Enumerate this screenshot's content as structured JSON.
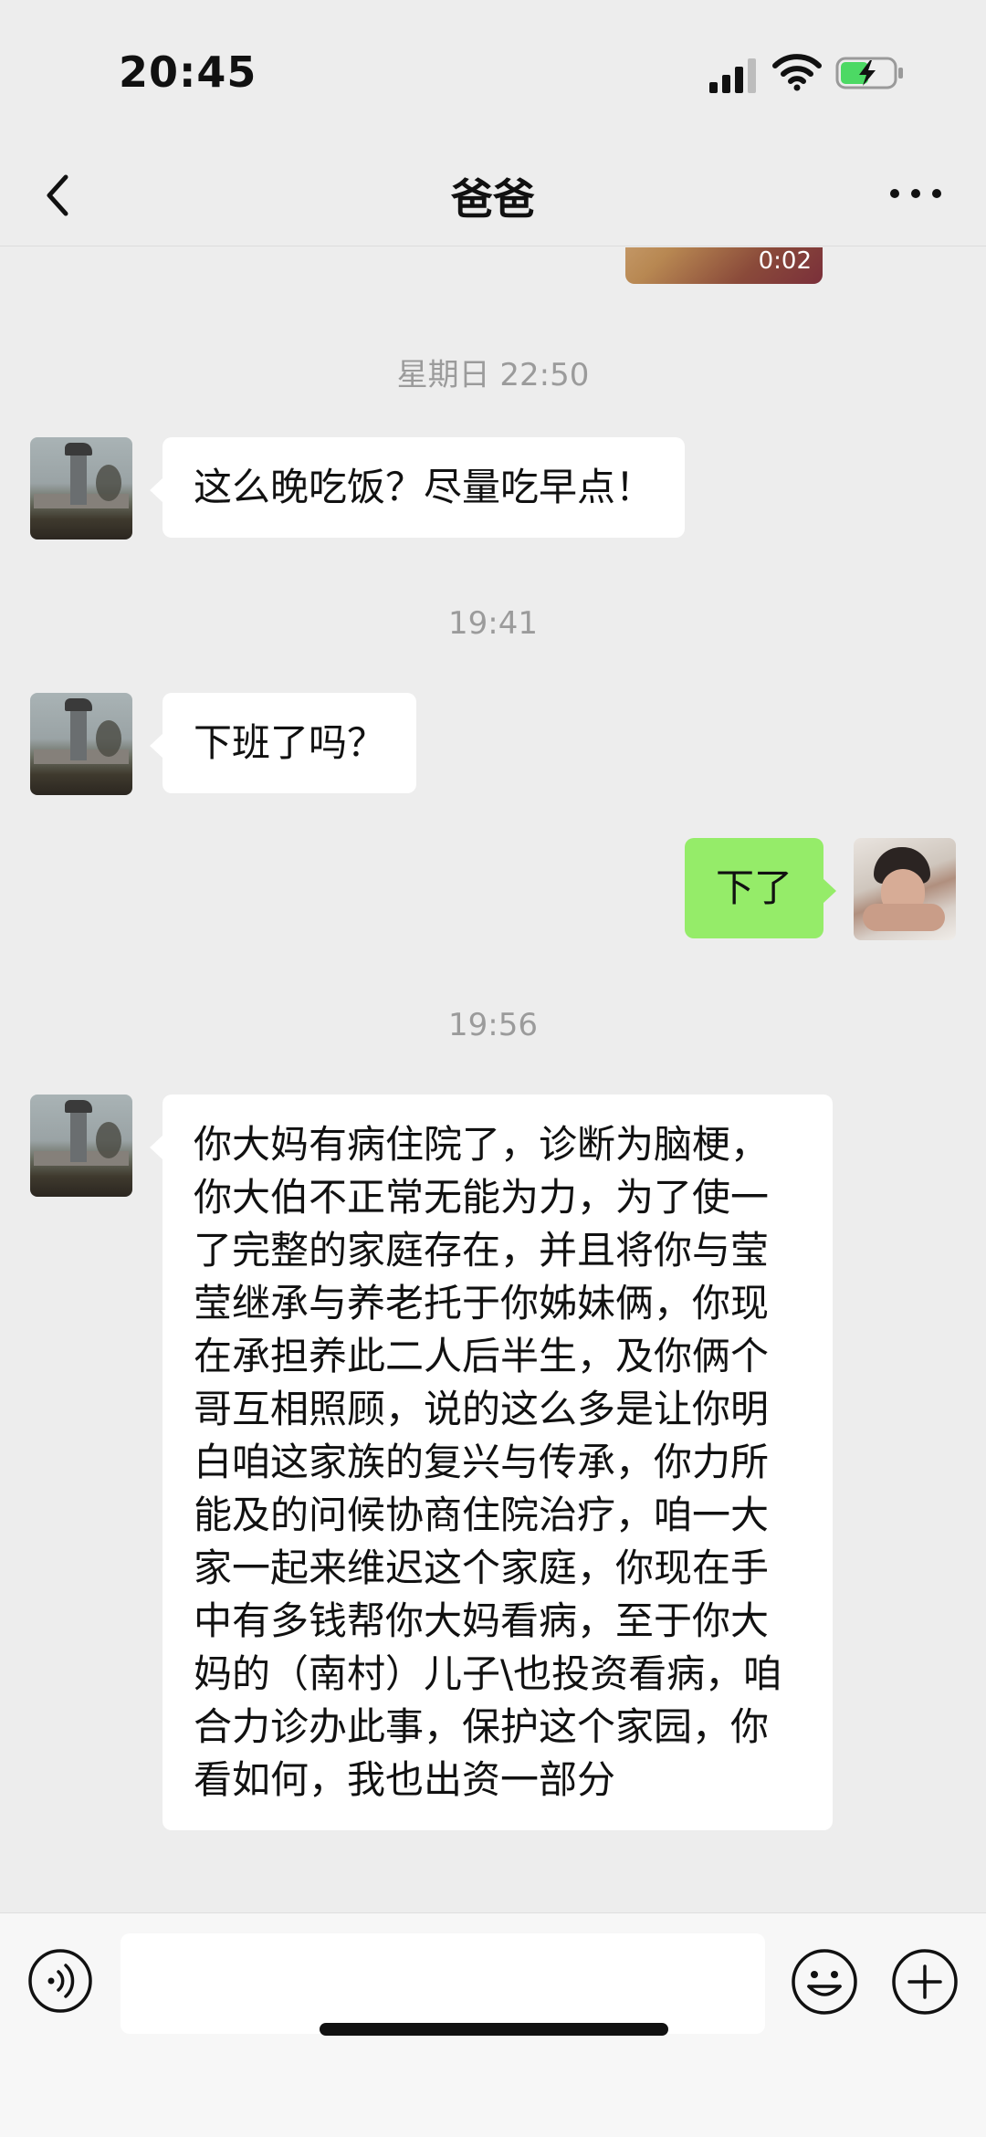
{
  "status_bar": {
    "time": "20:45",
    "icons": [
      "signal-icon",
      "wifi-icon",
      "battery-charging-icon"
    ]
  },
  "nav": {
    "title": "爸爸",
    "back_icon": "chevron-left-icon",
    "more_icon": "more-dots-icon"
  },
  "messages": {
    "video_duration": "0:02",
    "ts1": "星期日 22:50",
    "msg1": "这么晚吃饭？尽量吃早点！",
    "ts2": "19:41",
    "msg2": "下班了吗？",
    "msg3": "下了",
    "ts3": "19:56",
    "msg4": "你大妈有病住院了，诊断为脑梗，你大伯不正常无能为力，为了使一了完整的家庭存在，并且将你与莹莹继承与养老托于你姊妹俩，你现在承担养此二人后半生，及你俩个哥互相照顾，说的这么多是让你明白咱这家族的复兴与传承，你力所能及的问候协商住院治疗，咱一大家一起来维迟这个家庭，你现在手中有多钱帮你大妈看病，至于你大妈的（南村）儿子\\也投资看病，咱合力诊办此事，保护这个家园，你看如何，我也出资一部分"
  },
  "input_bar": {
    "value": "",
    "voice_icon": "voice-icon",
    "emoji_icon": "emoji-icon",
    "plus_icon": "plus-icon"
  },
  "colors": {
    "background": "#ededed",
    "incoming_bubble": "#ffffff",
    "outgoing_bubble": "#95ec69",
    "timestamp": "#9b9b9b"
  }
}
